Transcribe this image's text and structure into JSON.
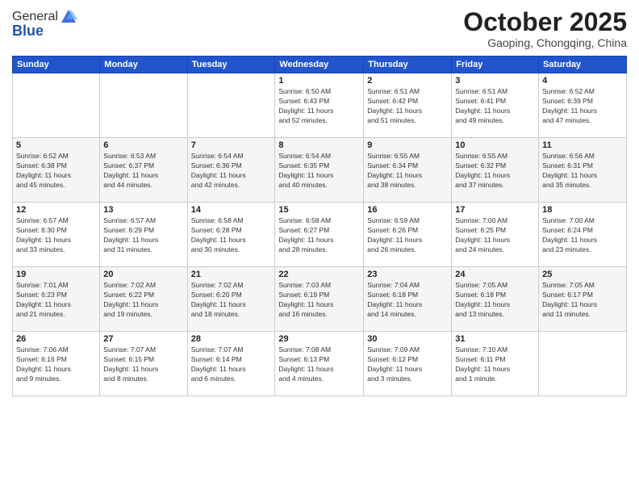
{
  "header": {
    "logo_general": "General",
    "logo_blue": "Blue",
    "month": "October 2025",
    "location": "Gaoping, Chongqing, China"
  },
  "weekdays": [
    "Sunday",
    "Monday",
    "Tuesday",
    "Wednesday",
    "Thursday",
    "Friday",
    "Saturday"
  ],
  "weeks": [
    [
      {
        "day": "",
        "info": ""
      },
      {
        "day": "",
        "info": ""
      },
      {
        "day": "",
        "info": ""
      },
      {
        "day": "1",
        "info": "Sunrise: 6:50 AM\nSunset: 6:43 PM\nDaylight: 11 hours\nand 52 minutes."
      },
      {
        "day": "2",
        "info": "Sunrise: 6:51 AM\nSunset: 6:42 PM\nDaylight: 11 hours\nand 51 minutes."
      },
      {
        "day": "3",
        "info": "Sunrise: 6:51 AM\nSunset: 6:41 PM\nDaylight: 11 hours\nand 49 minutes."
      },
      {
        "day": "4",
        "info": "Sunrise: 6:52 AM\nSunset: 6:39 PM\nDaylight: 11 hours\nand 47 minutes."
      }
    ],
    [
      {
        "day": "5",
        "info": "Sunrise: 6:52 AM\nSunset: 6:38 PM\nDaylight: 11 hours\nand 45 minutes."
      },
      {
        "day": "6",
        "info": "Sunrise: 6:53 AM\nSunset: 6:37 PM\nDaylight: 11 hours\nand 44 minutes."
      },
      {
        "day": "7",
        "info": "Sunrise: 6:54 AM\nSunset: 6:36 PM\nDaylight: 11 hours\nand 42 minutes."
      },
      {
        "day": "8",
        "info": "Sunrise: 6:54 AM\nSunset: 6:35 PM\nDaylight: 11 hours\nand 40 minutes."
      },
      {
        "day": "9",
        "info": "Sunrise: 6:55 AM\nSunset: 6:34 PM\nDaylight: 11 hours\nand 38 minutes."
      },
      {
        "day": "10",
        "info": "Sunrise: 6:55 AM\nSunset: 6:32 PM\nDaylight: 11 hours\nand 37 minutes."
      },
      {
        "day": "11",
        "info": "Sunrise: 6:56 AM\nSunset: 6:31 PM\nDaylight: 11 hours\nand 35 minutes."
      }
    ],
    [
      {
        "day": "12",
        "info": "Sunrise: 6:57 AM\nSunset: 6:30 PM\nDaylight: 11 hours\nand 33 minutes."
      },
      {
        "day": "13",
        "info": "Sunrise: 6:57 AM\nSunset: 6:29 PM\nDaylight: 11 hours\nand 31 minutes."
      },
      {
        "day": "14",
        "info": "Sunrise: 6:58 AM\nSunset: 6:28 PM\nDaylight: 11 hours\nand 30 minutes."
      },
      {
        "day": "15",
        "info": "Sunrise: 6:58 AM\nSunset: 6:27 PM\nDaylight: 11 hours\nand 28 minutes."
      },
      {
        "day": "16",
        "info": "Sunrise: 6:59 AM\nSunset: 6:26 PM\nDaylight: 11 hours\nand 26 minutes."
      },
      {
        "day": "17",
        "info": "Sunrise: 7:00 AM\nSunset: 6:25 PM\nDaylight: 11 hours\nand 24 minutes."
      },
      {
        "day": "18",
        "info": "Sunrise: 7:00 AM\nSunset: 6:24 PM\nDaylight: 11 hours\nand 23 minutes."
      }
    ],
    [
      {
        "day": "19",
        "info": "Sunrise: 7:01 AM\nSunset: 6:23 PM\nDaylight: 11 hours\nand 21 minutes."
      },
      {
        "day": "20",
        "info": "Sunrise: 7:02 AM\nSunset: 6:22 PM\nDaylight: 11 hours\nand 19 minutes."
      },
      {
        "day": "21",
        "info": "Sunrise: 7:02 AM\nSunset: 6:20 PM\nDaylight: 11 hours\nand 18 minutes."
      },
      {
        "day": "22",
        "info": "Sunrise: 7:03 AM\nSunset: 6:19 PM\nDaylight: 11 hours\nand 16 minutes."
      },
      {
        "day": "23",
        "info": "Sunrise: 7:04 AM\nSunset: 6:18 PM\nDaylight: 11 hours\nand 14 minutes."
      },
      {
        "day": "24",
        "info": "Sunrise: 7:05 AM\nSunset: 6:18 PM\nDaylight: 11 hours\nand 13 minutes."
      },
      {
        "day": "25",
        "info": "Sunrise: 7:05 AM\nSunset: 6:17 PM\nDaylight: 11 hours\nand 11 minutes."
      }
    ],
    [
      {
        "day": "26",
        "info": "Sunrise: 7:06 AM\nSunset: 6:16 PM\nDaylight: 11 hours\nand 9 minutes."
      },
      {
        "day": "27",
        "info": "Sunrise: 7:07 AM\nSunset: 6:15 PM\nDaylight: 11 hours\nand 8 minutes."
      },
      {
        "day": "28",
        "info": "Sunrise: 7:07 AM\nSunset: 6:14 PM\nDaylight: 11 hours\nand 6 minutes."
      },
      {
        "day": "29",
        "info": "Sunrise: 7:08 AM\nSunset: 6:13 PM\nDaylight: 11 hours\nand 4 minutes."
      },
      {
        "day": "30",
        "info": "Sunrise: 7:09 AM\nSunset: 6:12 PM\nDaylight: 11 hours\nand 3 minutes."
      },
      {
        "day": "31",
        "info": "Sunrise: 7:10 AM\nSunset: 6:11 PM\nDaylight: 11 hours\nand 1 minute."
      },
      {
        "day": "",
        "info": ""
      }
    ]
  ]
}
